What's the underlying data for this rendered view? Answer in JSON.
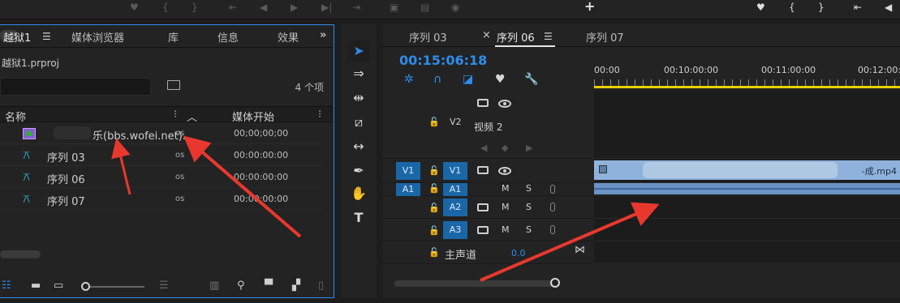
{
  "project_panel": {
    "tabs": [
      {
        "label": "越狱1"
      },
      {
        "label": "媒体浏览器"
      },
      {
        "label": "库"
      },
      {
        "label": "信息"
      },
      {
        "label": "效果"
      }
    ],
    "overflow": "»",
    "project_file": "越狱1.prproj",
    "search_placeholder": "",
    "item_count": "4 个项",
    "columns": {
      "name": "名称",
      "media_start": "媒体开始"
    },
    "items": [
      {
        "name": "乐(bbs.wofei.net).",
        "fps": "os",
        "start": "00;00;00;00",
        "icon": "clip-icon"
      },
      {
        "name": "序列 03",
        "fps": "os",
        "start": "00:00:00:00",
        "icon": "sequence-icon"
      },
      {
        "name": "序列 06",
        "fps": "os",
        "start": "00:00:00:00",
        "icon": "sequence-icon"
      },
      {
        "name": "序列 07",
        "fps": "os",
        "start": "00:00:00:00",
        "icon": "sequence-icon"
      }
    ]
  },
  "timeline": {
    "tabs": [
      {
        "label": "序列 03"
      },
      {
        "label": "序列 06"
      },
      {
        "label": "序列 07"
      }
    ],
    "close_glyph": "×",
    "timecode": "00:15:06:18",
    "ruler_labels": [
      "00:00",
      "00:10:00:00",
      "00:11:00:00",
      "00:12:00:"
    ],
    "tracks": {
      "v2_label": "V2",
      "v2_name": "视频 2",
      "v1_source": "V1",
      "v1_label": "V1",
      "a1_source": "A1",
      "a1_label": "A1",
      "a2_label": "A2",
      "a3_label": "A3",
      "mute": "M",
      "solo": "S",
      "master": "主声道",
      "master_value": "0.0"
    },
    "clip_label": "-成.mp4"
  },
  "colors": {
    "accent": "#2d8ceb",
    "ruler_bar": "#e8d000",
    "clip_video": "#8fb2dc",
    "track_target": "#1a67a8"
  }
}
